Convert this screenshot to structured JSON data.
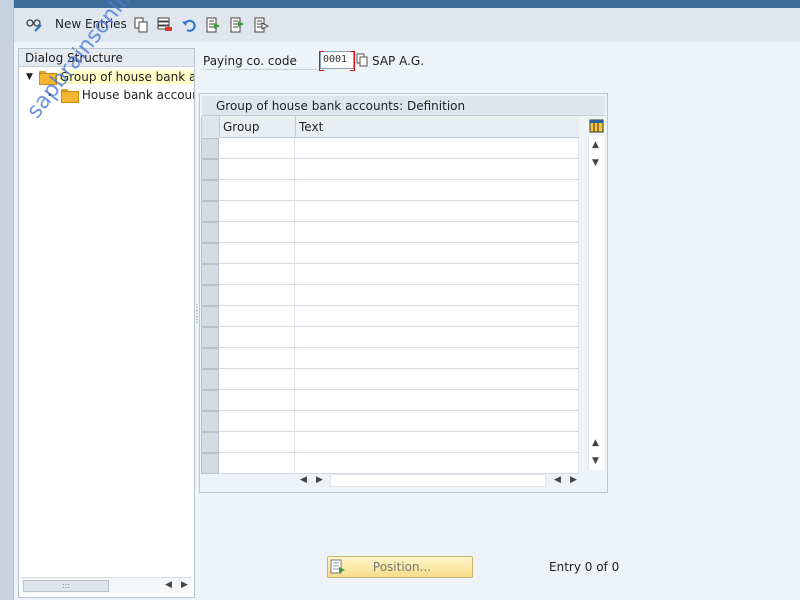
{
  "toolbar": {
    "new_entries_label": "New Entries",
    "icons": [
      "edit-glasses-icon",
      "copy-icon",
      "delete-icon",
      "undo-icon",
      "select-all-icon",
      "select-block-icon",
      "deselect-all-icon"
    ]
  },
  "dialog_structure": {
    "header": "Dialog Structure",
    "items": [
      {
        "label": "Group of house bank acc",
        "expanded": true,
        "selected": true
      },
      {
        "label": "House bank accounts",
        "expanded": false,
        "selected": false
      }
    ]
  },
  "field": {
    "label": "Paying co. code",
    "value": "0001",
    "description": "SAP A.G."
  },
  "table": {
    "title": "Group of house bank accounts: Definition",
    "columns": [
      "Group",
      "Text"
    ],
    "rows": 16
  },
  "footer": {
    "position_label": "Position...",
    "entry_info": "Entry 0 of 0"
  },
  "watermark": "sapbrainsonline.com",
  "colors": {
    "accent": "#3d6d99",
    "selected_tree": "#ffffc8",
    "button_yellow": "#f7dd8a",
    "required_marker": "#d11111"
  }
}
